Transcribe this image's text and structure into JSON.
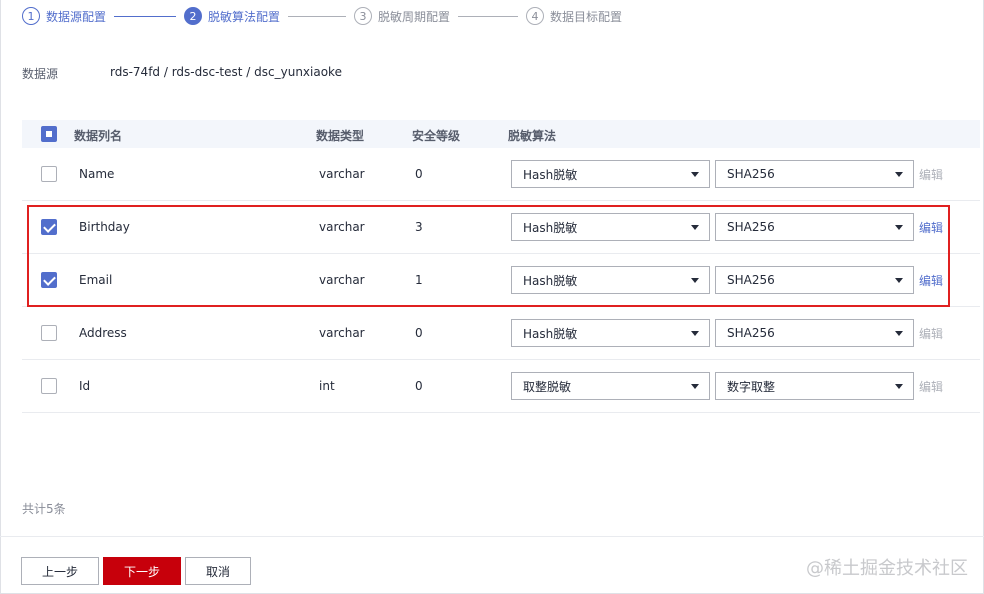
{
  "stepper": [
    {
      "num": "1",
      "label": "数据源配置",
      "state": "done"
    },
    {
      "num": "2",
      "label": "脱敏算法配置",
      "state": "active"
    },
    {
      "num": "3",
      "label": "脱敏周期配置",
      "state": "todo"
    },
    {
      "num": "4",
      "label": "数据目标配置",
      "state": "todo"
    }
  ],
  "datasource": {
    "label": "数据源",
    "value": "rds-74fd / rds-dsc-test / dsc_yunxiaoke"
  },
  "table": {
    "headers": {
      "name": "数据列名",
      "type": "数据类型",
      "level": "安全等级",
      "algo": "脱敏算法"
    },
    "rows": [
      {
        "name": "Name",
        "type": "varchar",
        "level": "0",
        "algo": "Hash脱敏",
        "param": "SHA256",
        "edit": "编辑",
        "checked": false
      },
      {
        "name": "Birthday",
        "type": "varchar",
        "level": "3",
        "algo": "Hash脱敏",
        "param": "SHA256",
        "edit": "编辑",
        "checked": true
      },
      {
        "name": "Email",
        "type": "varchar",
        "level": "1",
        "algo": "Hash脱敏",
        "param": "SHA256",
        "edit": "编辑",
        "checked": true
      },
      {
        "name": "Address",
        "type": "varchar",
        "level": "0",
        "algo": "Hash脱敏",
        "param": "SHA256",
        "edit": "编辑",
        "checked": false
      },
      {
        "name": "Id",
        "type": "int",
        "level": "0",
        "algo": "取整脱敏",
        "param": "数字取整",
        "edit": "编辑",
        "checked": false
      }
    ]
  },
  "total": "共计5条",
  "buttons": {
    "prev": "上一步",
    "next": "下一步",
    "cancel": "取消"
  },
  "watermark": "@稀土掘金技术社区",
  "colors": {
    "accent": "#526ecc",
    "primary_button": "#c7000b",
    "highlight_border": "#e02020"
  }
}
